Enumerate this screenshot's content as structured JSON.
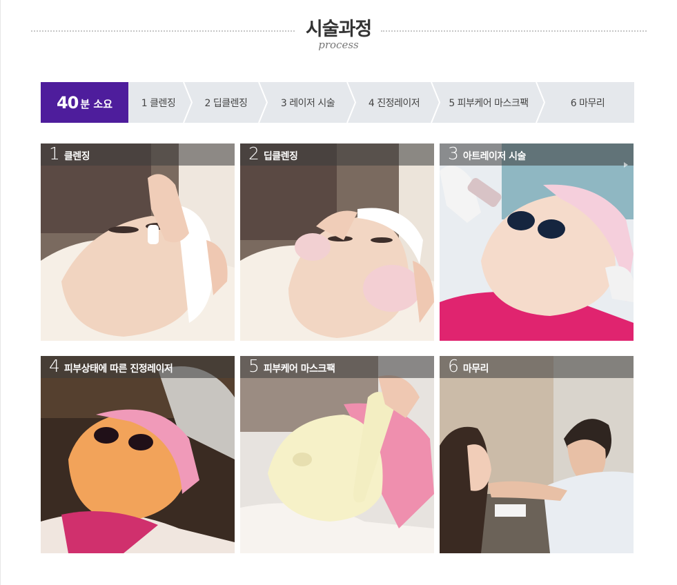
{
  "header": {
    "title": "시술과정",
    "subtitle": "process"
  },
  "steps_bar": {
    "duration_number": "40",
    "duration_unit": "분 소요",
    "items": [
      {
        "label": "1 클렌징"
      },
      {
        "label": "2 딥클렌징"
      },
      {
        "label": "3 레이저 시술"
      },
      {
        "label": "4 진정레이저"
      },
      {
        "label": "5 피부케어 마스크팩"
      },
      {
        "label": "6 마무리"
      }
    ]
  },
  "photos": [
    {
      "number": "1",
      "caption": "클렌징"
    },
    {
      "number": "2",
      "caption": "딥클렌징"
    },
    {
      "number": "3",
      "caption": "아트레이저 시술"
    },
    {
      "number": "4",
      "caption": "피부상태에 따른 진정레이저"
    },
    {
      "number": "5",
      "caption": "피부케어 마스크팩"
    },
    {
      "number": "6",
      "caption": "마무리"
    }
  ],
  "colors": {
    "accent": "#4e1d9c",
    "steps_bg": "#e5e8ec",
    "dots": "#c6c6c6"
  }
}
